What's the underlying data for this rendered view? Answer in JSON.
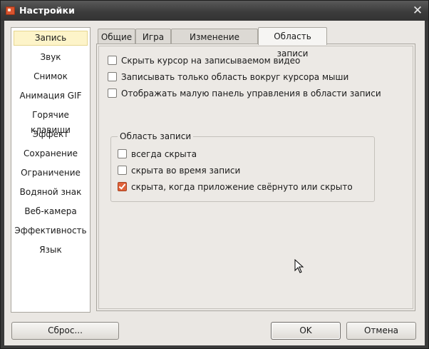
{
  "window": {
    "title": "Настройки",
    "close_glyph": "✕"
  },
  "sidebar": {
    "items": [
      {
        "label": "Запись",
        "selected": true
      },
      {
        "label": "Звук"
      },
      {
        "label": "Снимок"
      },
      {
        "label": "Анимация GIF"
      },
      {
        "label": "Горячие клавиши"
      },
      {
        "label": "Эффект"
      },
      {
        "label": "Сохранение"
      },
      {
        "label": "Ограничение"
      },
      {
        "label": "Водяной знак"
      },
      {
        "label": "Веб-камера"
      },
      {
        "label": "Эффективность"
      },
      {
        "label": "Язык"
      }
    ]
  },
  "tabs": [
    {
      "label": "Общие"
    },
    {
      "label": "Игра"
    },
    {
      "label": "Изменение размера"
    },
    {
      "label": "Область записи",
      "active": true
    }
  ],
  "options": [
    {
      "label": "Скрыть курсор на записываемом видео",
      "checked": false
    },
    {
      "label": "Записывать только область вокруг курсора мыши",
      "checked": false
    },
    {
      "label": "Отображать малую панель управления в области записи",
      "checked": false
    }
  ],
  "area_group": {
    "title": "Область записи",
    "options": [
      {
        "label": "всегда скрыта",
        "checked": false
      },
      {
        "label": "скрыта во время записи",
        "checked": false
      },
      {
        "label": "скрыта, когда приложение свёрнуто или скрыто",
        "checked": true
      }
    ]
  },
  "buttons": {
    "reset": "Сброс...",
    "ok": "OK",
    "cancel": "Отмена"
  },
  "colors": {
    "title_bar": "#3c3c3c",
    "dialog_bg": "#eae7e3",
    "selected_item_bg": "#fdf4c9",
    "checked_accent": "#e0623a"
  }
}
